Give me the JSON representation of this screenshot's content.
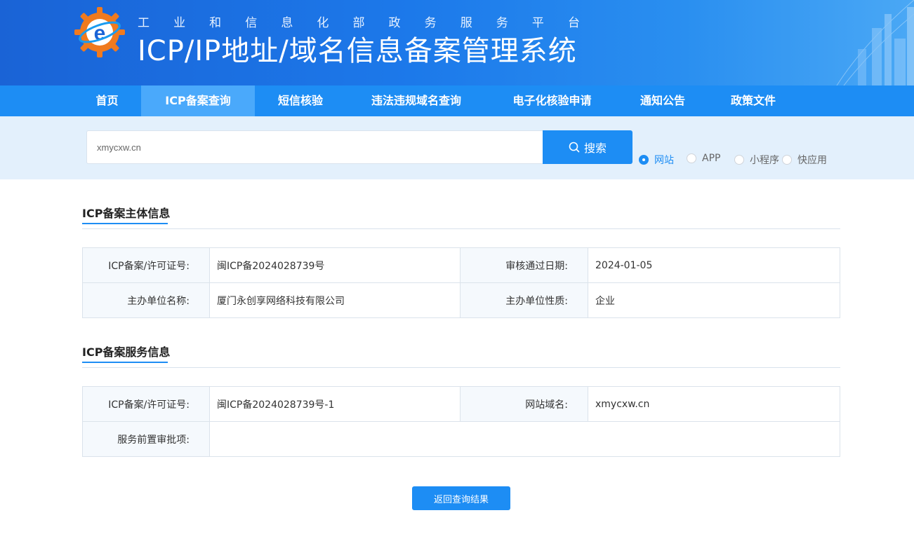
{
  "header": {
    "subtitle_chars": [
      "工",
      "业",
      "和",
      "信",
      "息",
      "化",
      "部",
      "政",
      "务",
      "服",
      "务",
      "平",
      "台"
    ],
    "title": "ICP/IP地址/域名信息备案管理系统",
    "logo_letter": "e"
  },
  "nav": {
    "items": [
      {
        "label": "首页"
      },
      {
        "label": "ICP备案查询"
      },
      {
        "label": "短信核验"
      },
      {
        "label": "违法违规域名查询"
      },
      {
        "label": "电子化核验申请"
      },
      {
        "label": "通知公告"
      },
      {
        "label": "政策文件"
      }
    ],
    "active_index": 1
  },
  "search": {
    "value": "xmycxw.cn",
    "button_label": "搜索",
    "radios": [
      {
        "label": "网站",
        "checked": true
      },
      {
        "label": "APP",
        "checked": false
      },
      {
        "label": "小程序",
        "checked": false
      },
      {
        "label": "快应用",
        "checked": false
      }
    ]
  },
  "subject_info": {
    "title": "ICP备案主体信息",
    "rows": [
      {
        "label1": "ICP备案/许可证号:",
        "value1": "闽ICP备2024028739号",
        "label2": "审核通过日期:",
        "value2": "2024-01-05"
      },
      {
        "label1": "主办单位名称:",
        "value1": "厦门永创享网络科技有限公司",
        "label2": "主办单位性质:",
        "value2": "企业"
      }
    ]
  },
  "service_info": {
    "title": "ICP备案服务信息",
    "row1": {
      "label1": "ICP备案/许可证号:",
      "value1": "闽ICP备2024028739号-1",
      "label2": "网站域名:",
      "value2": "xmycxw.cn"
    },
    "row2": {
      "label": "服务前置审批项:",
      "value": ""
    }
  },
  "back_button_label": "返回查询结果",
  "colors": {
    "primary": "#1d8df4",
    "nav_active": "#4aa9fb",
    "banner_start": "#1a63d6",
    "search_strip": "#e3f0fc",
    "logo_orange": "#f07a1e"
  }
}
